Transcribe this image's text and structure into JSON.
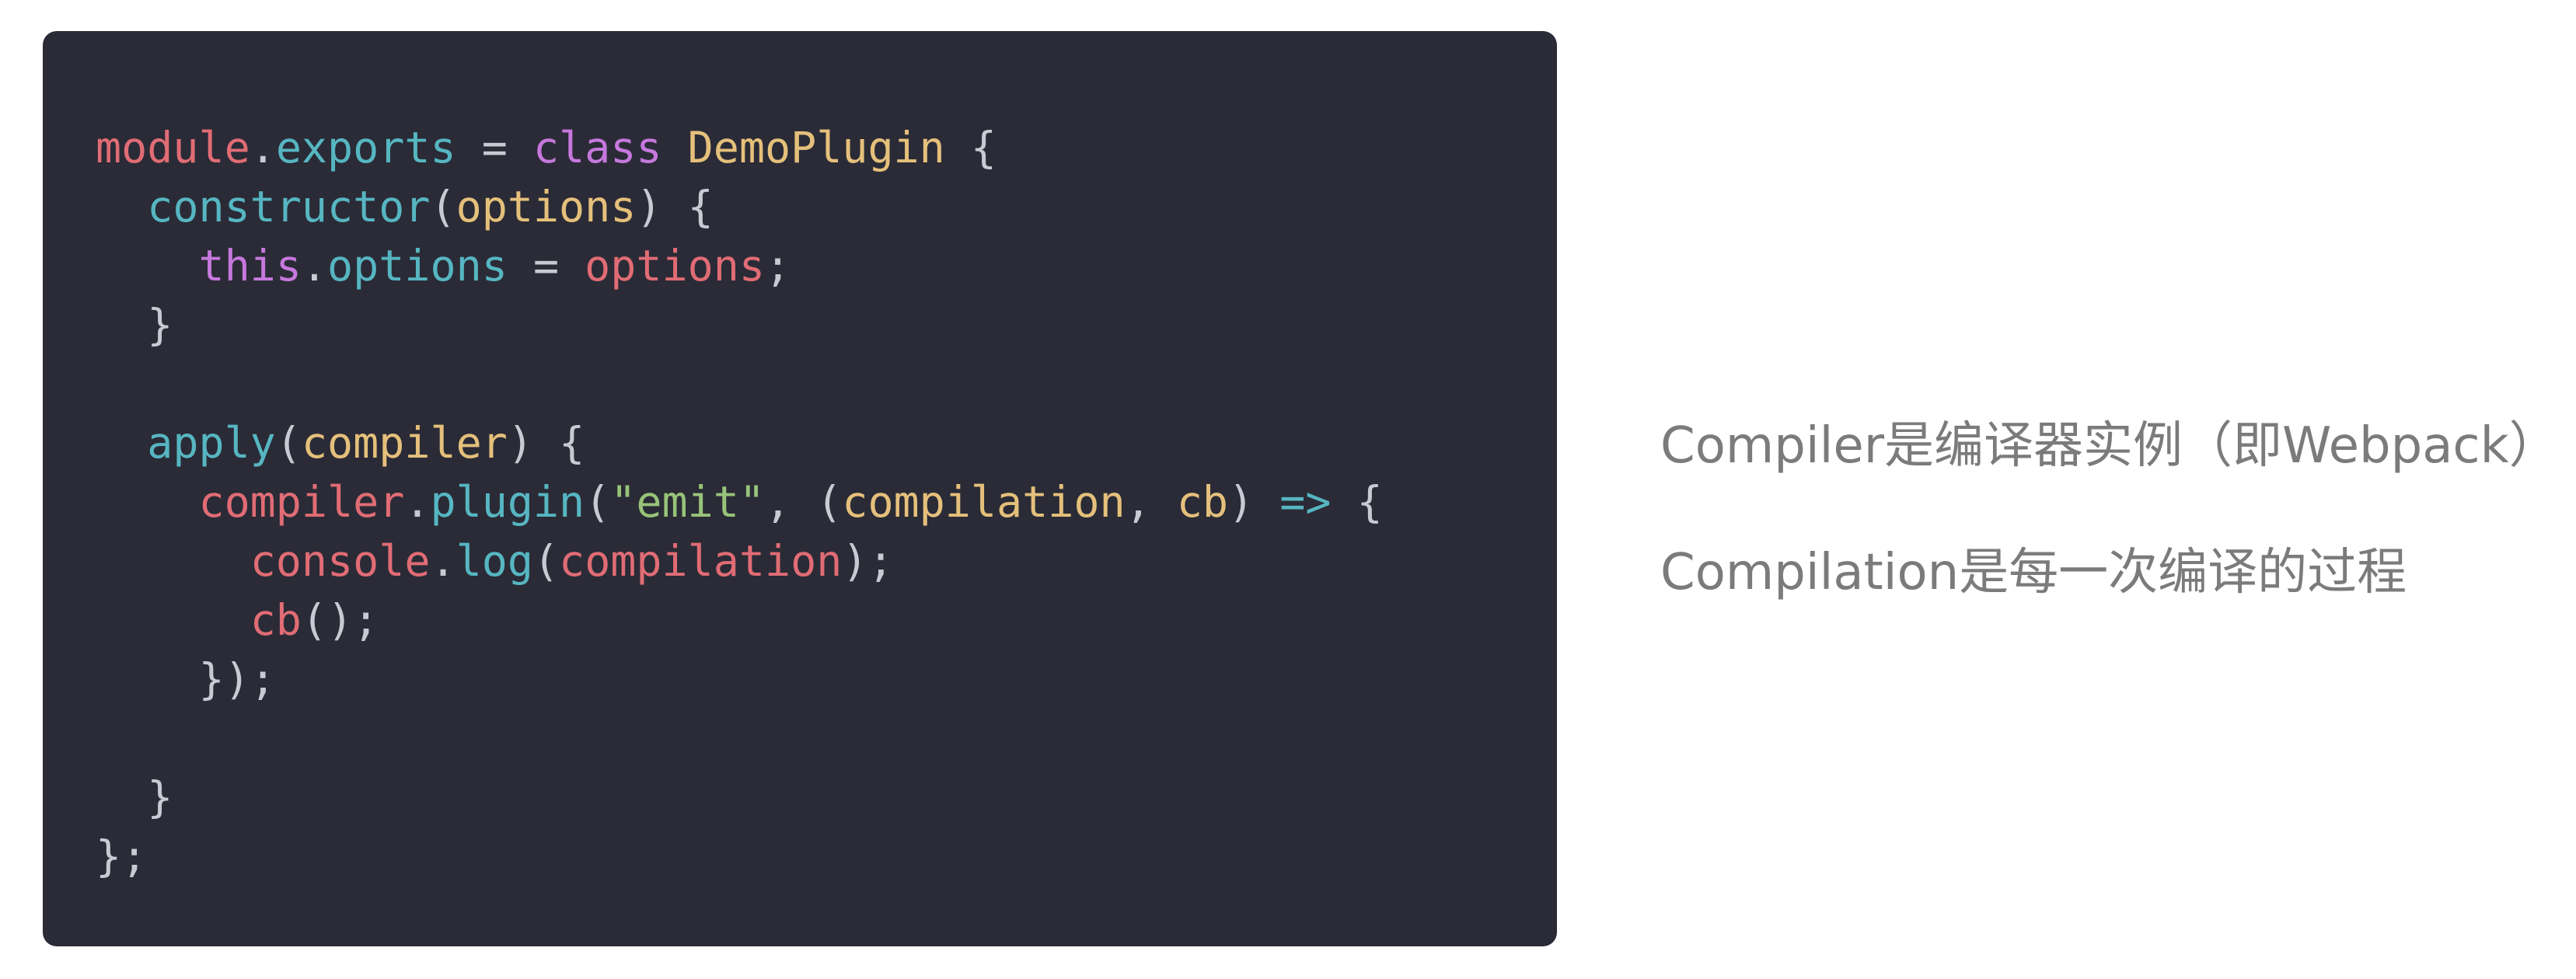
{
  "colors": {
    "panel_background": "#2a2b36",
    "page_background": "#ffffff",
    "caption_text": "#7b7b7b",
    "token_red": "#e06c75",
    "token_cyan": "#56b6c2",
    "token_purple": "#c678dd",
    "token_yellow": "#e5c07b",
    "token_green": "#98c379",
    "token_plain": "#c7c9d3"
  },
  "code": {
    "lines": [
      [
        {
          "t": "module",
          "c": "token_red"
        },
        {
          "t": ".",
          "c": "token_plain"
        },
        {
          "t": "exports",
          "c": "token_cyan"
        },
        {
          "t": " = ",
          "c": "token_plain"
        },
        {
          "t": "class",
          "c": "token_purple"
        },
        {
          "t": " ",
          "c": "token_plain"
        },
        {
          "t": "DemoPlugin",
          "c": "token_yellow"
        },
        {
          "t": " {",
          "c": "token_plain"
        }
      ],
      [
        {
          "t": "  ",
          "c": "token_plain"
        },
        {
          "t": "constructor",
          "c": "token_cyan"
        },
        {
          "t": "(",
          "c": "token_plain"
        },
        {
          "t": "options",
          "c": "token_yellow"
        },
        {
          "t": ") {",
          "c": "token_plain"
        }
      ],
      [
        {
          "t": "    ",
          "c": "token_plain"
        },
        {
          "t": "this",
          "c": "token_purple"
        },
        {
          "t": ".",
          "c": "token_plain"
        },
        {
          "t": "options",
          "c": "token_cyan"
        },
        {
          "t": " = ",
          "c": "token_plain"
        },
        {
          "t": "options",
          "c": "token_red"
        },
        {
          "t": ";",
          "c": "token_plain"
        }
      ],
      [
        {
          "t": "  }",
          "c": "token_plain"
        }
      ],
      [
        {
          "t": "",
          "c": "token_plain"
        }
      ],
      [
        {
          "t": "  ",
          "c": "token_plain"
        },
        {
          "t": "apply",
          "c": "token_cyan"
        },
        {
          "t": "(",
          "c": "token_plain"
        },
        {
          "t": "compiler",
          "c": "token_yellow"
        },
        {
          "t": ") {",
          "c": "token_plain"
        }
      ],
      [
        {
          "t": "    ",
          "c": "token_plain"
        },
        {
          "t": "compiler",
          "c": "token_red"
        },
        {
          "t": ".",
          "c": "token_plain"
        },
        {
          "t": "plugin",
          "c": "token_cyan"
        },
        {
          "t": "(",
          "c": "token_plain"
        },
        {
          "t": "\"emit\"",
          "c": "token_green"
        },
        {
          "t": ", (",
          "c": "token_plain"
        },
        {
          "t": "compilation",
          "c": "token_yellow"
        },
        {
          "t": ", ",
          "c": "token_plain"
        },
        {
          "t": "cb",
          "c": "token_yellow"
        },
        {
          "t": ") ",
          "c": "token_plain"
        },
        {
          "t": "=>",
          "c": "token_cyan"
        },
        {
          "t": " {",
          "c": "token_plain"
        }
      ],
      [
        {
          "t": "      ",
          "c": "token_plain"
        },
        {
          "t": "console",
          "c": "token_red"
        },
        {
          "t": ".",
          "c": "token_plain"
        },
        {
          "t": "log",
          "c": "token_cyan"
        },
        {
          "t": "(",
          "c": "token_plain"
        },
        {
          "t": "compilation",
          "c": "token_red"
        },
        {
          "t": ");",
          "c": "token_plain"
        }
      ],
      [
        {
          "t": "      ",
          "c": "token_plain"
        },
        {
          "t": "cb",
          "c": "token_red"
        },
        {
          "t": "();",
          "c": "token_plain"
        }
      ],
      [
        {
          "t": "    });",
          "c": "token_plain"
        }
      ],
      [
        {
          "t": "",
          "c": "token_plain"
        }
      ],
      [
        {
          "t": "  }",
          "c": "token_plain"
        }
      ],
      [
        {
          "t": "};",
          "c": "token_plain"
        }
      ]
    ]
  },
  "captions": {
    "compiler_note": "Compiler是编译器实例（即Webpack）",
    "compilation_note": "Compilation是每一次编译的过程"
  }
}
